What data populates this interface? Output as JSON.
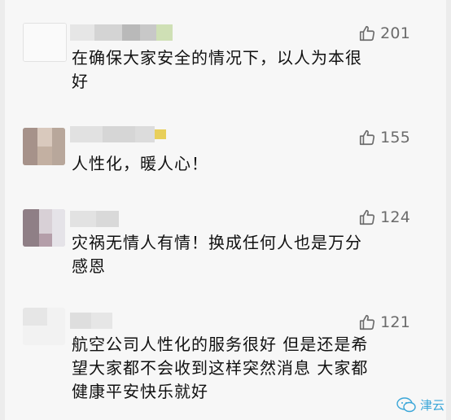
{
  "comments": [
    {
      "likes": "201",
      "text": "在确保大家安全的情况下，以人为本很\n好"
    },
    {
      "likes": "155",
      "text": "人性化，暖人心！"
    },
    {
      "likes": "124",
      "text": "灾祸无情人有情！换成任何人也是万分\n感恩"
    },
    {
      "likes": "121",
      "text": "航空公司人性化的服务很好  但是还是希\n望大家都不会收到这样突然消息  大家都\n健康平安快乐就好"
    }
  ],
  "watermark": {
    "text": "津云",
    "icon": "wechat-bubble-icon"
  },
  "colors": {
    "like_gray": "#6b6b6b",
    "watermark_blue": "#3aa6d8"
  }
}
